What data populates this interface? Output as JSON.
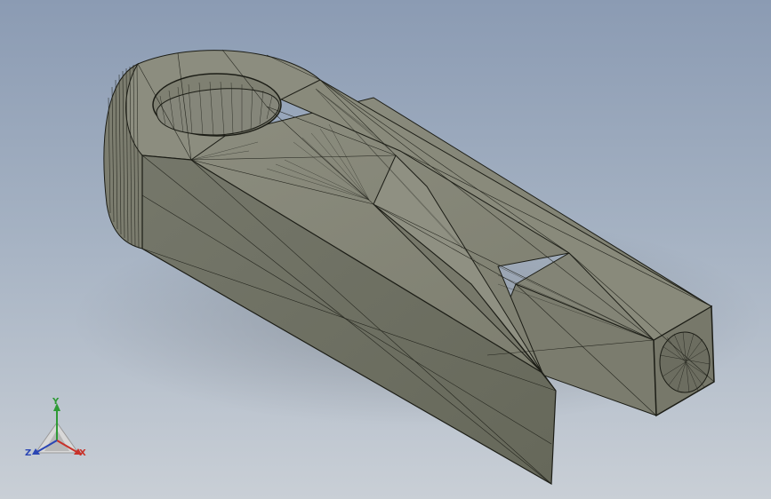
{
  "viewport": {
    "background_top": "#8b9bb3",
    "background_bottom": "#c9cfd6",
    "model_face_color": "#858677",
    "model_side_color": "#707262",
    "model_edge_color": "#1c1d16"
  },
  "triad": {
    "x_label": "X",
    "y_label": "Y",
    "z_label": "Z",
    "x_color": "#c8322a",
    "y_color": "#2e9a36",
    "z_color": "#2b46b4"
  }
}
